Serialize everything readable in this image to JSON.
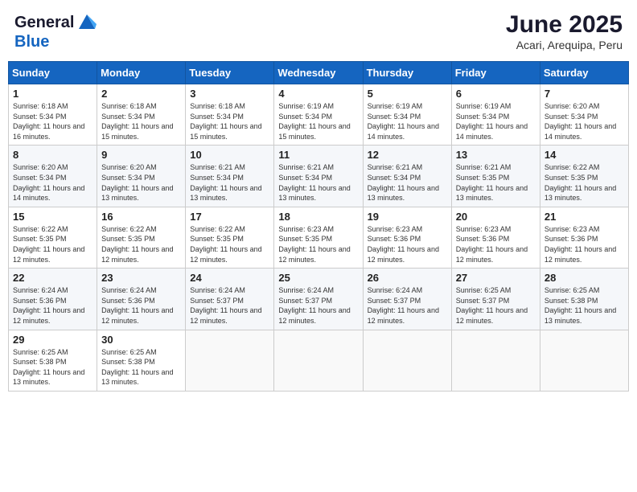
{
  "logo": {
    "general": "General",
    "blue": "Blue"
  },
  "header": {
    "month": "June 2025",
    "location": "Acari, Arequipa, Peru"
  },
  "weekdays": [
    "Sunday",
    "Monday",
    "Tuesday",
    "Wednesday",
    "Thursday",
    "Friday",
    "Saturday"
  ],
  "weeks": [
    [
      {
        "day": "1",
        "sunrise": "6:18 AM",
        "sunset": "5:34 PM",
        "daylight": "11 hours and 16 minutes."
      },
      {
        "day": "2",
        "sunrise": "6:18 AM",
        "sunset": "5:34 PM",
        "daylight": "11 hours and 15 minutes."
      },
      {
        "day": "3",
        "sunrise": "6:18 AM",
        "sunset": "5:34 PM",
        "daylight": "11 hours and 15 minutes."
      },
      {
        "day": "4",
        "sunrise": "6:19 AM",
        "sunset": "5:34 PM",
        "daylight": "11 hours and 15 minutes."
      },
      {
        "day": "5",
        "sunrise": "6:19 AM",
        "sunset": "5:34 PM",
        "daylight": "11 hours and 14 minutes."
      },
      {
        "day": "6",
        "sunrise": "6:19 AM",
        "sunset": "5:34 PM",
        "daylight": "11 hours and 14 minutes."
      },
      {
        "day": "7",
        "sunrise": "6:20 AM",
        "sunset": "5:34 PM",
        "daylight": "11 hours and 14 minutes."
      }
    ],
    [
      {
        "day": "8",
        "sunrise": "6:20 AM",
        "sunset": "5:34 PM",
        "daylight": "11 hours and 14 minutes."
      },
      {
        "day": "9",
        "sunrise": "6:20 AM",
        "sunset": "5:34 PM",
        "daylight": "11 hours and 13 minutes."
      },
      {
        "day": "10",
        "sunrise": "6:21 AM",
        "sunset": "5:34 PM",
        "daylight": "11 hours and 13 minutes."
      },
      {
        "day": "11",
        "sunrise": "6:21 AM",
        "sunset": "5:34 PM",
        "daylight": "11 hours and 13 minutes."
      },
      {
        "day": "12",
        "sunrise": "6:21 AM",
        "sunset": "5:34 PM",
        "daylight": "11 hours and 13 minutes."
      },
      {
        "day": "13",
        "sunrise": "6:21 AM",
        "sunset": "5:35 PM",
        "daylight": "11 hours and 13 minutes."
      },
      {
        "day": "14",
        "sunrise": "6:22 AM",
        "sunset": "5:35 PM",
        "daylight": "11 hours and 13 minutes."
      }
    ],
    [
      {
        "day": "15",
        "sunrise": "6:22 AM",
        "sunset": "5:35 PM",
        "daylight": "11 hours and 12 minutes."
      },
      {
        "day": "16",
        "sunrise": "6:22 AM",
        "sunset": "5:35 PM",
        "daylight": "11 hours and 12 minutes."
      },
      {
        "day": "17",
        "sunrise": "6:22 AM",
        "sunset": "5:35 PM",
        "daylight": "11 hours and 12 minutes."
      },
      {
        "day": "18",
        "sunrise": "6:23 AM",
        "sunset": "5:35 PM",
        "daylight": "11 hours and 12 minutes."
      },
      {
        "day": "19",
        "sunrise": "6:23 AM",
        "sunset": "5:36 PM",
        "daylight": "11 hours and 12 minutes."
      },
      {
        "day": "20",
        "sunrise": "6:23 AM",
        "sunset": "5:36 PM",
        "daylight": "11 hours and 12 minutes."
      },
      {
        "day": "21",
        "sunrise": "6:23 AM",
        "sunset": "5:36 PM",
        "daylight": "11 hours and 12 minutes."
      }
    ],
    [
      {
        "day": "22",
        "sunrise": "6:24 AM",
        "sunset": "5:36 PM",
        "daylight": "11 hours and 12 minutes."
      },
      {
        "day": "23",
        "sunrise": "6:24 AM",
        "sunset": "5:36 PM",
        "daylight": "11 hours and 12 minutes."
      },
      {
        "day": "24",
        "sunrise": "6:24 AM",
        "sunset": "5:37 PM",
        "daylight": "11 hours and 12 minutes."
      },
      {
        "day": "25",
        "sunrise": "6:24 AM",
        "sunset": "5:37 PM",
        "daylight": "11 hours and 12 minutes."
      },
      {
        "day": "26",
        "sunrise": "6:24 AM",
        "sunset": "5:37 PM",
        "daylight": "11 hours and 12 minutes."
      },
      {
        "day": "27",
        "sunrise": "6:25 AM",
        "sunset": "5:37 PM",
        "daylight": "11 hours and 12 minutes."
      },
      {
        "day": "28",
        "sunrise": "6:25 AM",
        "sunset": "5:38 PM",
        "daylight": "11 hours and 13 minutes."
      }
    ],
    [
      {
        "day": "29",
        "sunrise": "6:25 AM",
        "sunset": "5:38 PM",
        "daylight": "11 hours and 13 minutes."
      },
      {
        "day": "30",
        "sunrise": "6:25 AM",
        "sunset": "5:38 PM",
        "daylight": "11 hours and 13 minutes."
      },
      null,
      null,
      null,
      null,
      null
    ]
  ]
}
